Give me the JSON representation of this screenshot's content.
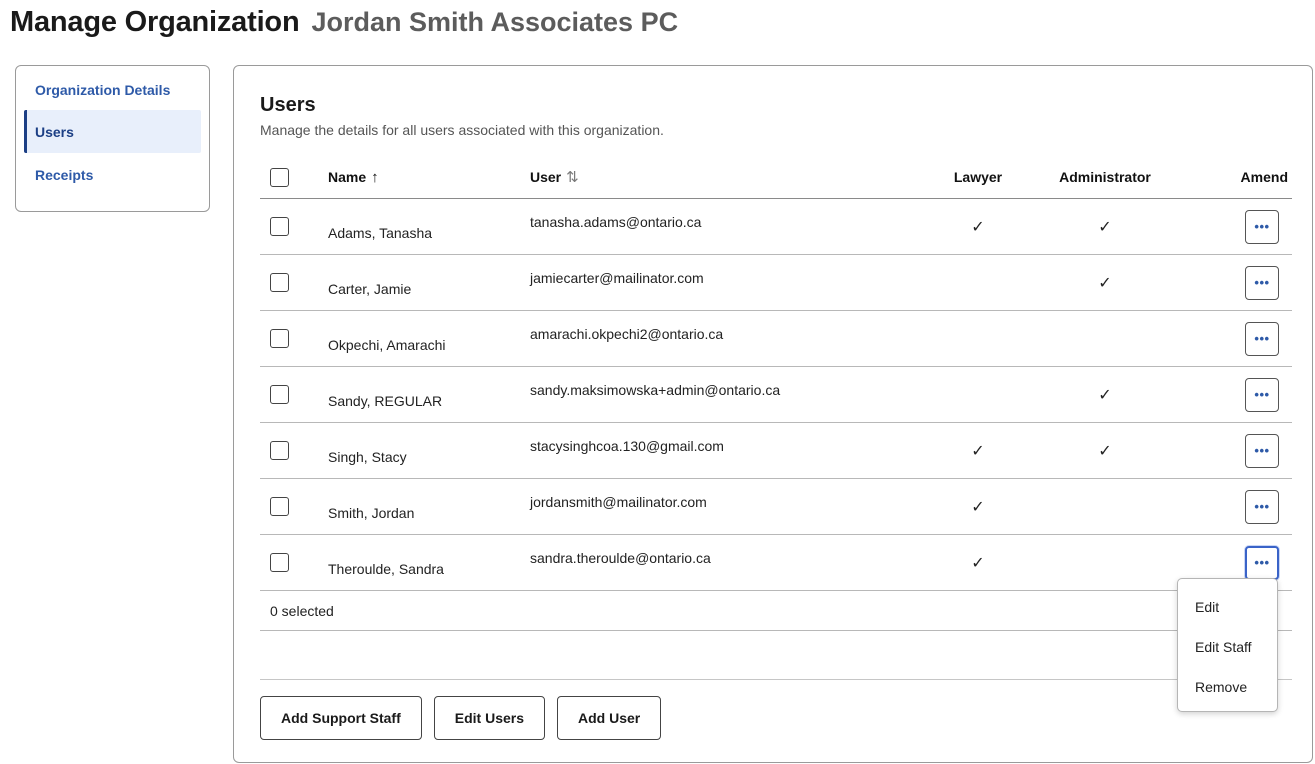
{
  "header": {
    "title": "Manage Organization",
    "org_name": "Jordan Smith Associates PC"
  },
  "sidebar": {
    "items": [
      {
        "label": "Organization Details",
        "active": false
      },
      {
        "label": "Users",
        "active": true
      },
      {
        "label": "Receipts",
        "active": false
      }
    ]
  },
  "users_section": {
    "title": "Users",
    "subtitle": "Manage the details for all users associated with this organization.",
    "columns": {
      "name": "Name",
      "user": "User",
      "lawyer": "Lawyer",
      "administrator": "Administrator",
      "amend": "Amend"
    },
    "sort_icons": {
      "name": "↑",
      "user": "⇅"
    },
    "rows": [
      {
        "name": "Adams, Tanasha",
        "email": "tanasha.adams@ontario.ca",
        "lawyer": "✓",
        "administrator": "✓"
      },
      {
        "name": "Carter, Jamie",
        "email": "jamiecarter@mailinator.com",
        "lawyer": "",
        "administrator": "✓"
      },
      {
        "name": "Okpechi, Amarachi",
        "email": "amarachi.okpechi2@ontario.ca",
        "lawyer": "",
        "administrator": ""
      },
      {
        "name": "Sandy, REGULAR",
        "email": "sandy.maksimowska+admin@ontario.ca",
        "lawyer": "",
        "administrator": "✓"
      },
      {
        "name": "Singh, Stacy",
        "email": "stacysinghcoa.130@gmail.com",
        "lawyer": "✓",
        "administrator": "✓"
      },
      {
        "name": "Smith, Jordan",
        "email": "jordansmith@mailinator.com",
        "lawyer": "✓",
        "administrator": ""
      },
      {
        "name": "Theroulde, Sandra",
        "email": "sandra.theroulde@ontario.ca",
        "lawyer": "✓",
        "administrator": ""
      }
    ],
    "amend_glyph": "•••",
    "selected_text": "0 selected"
  },
  "actions": {
    "add_support_staff": "Add Support Staff",
    "edit_users": "Edit Users",
    "add_user": "Add User"
  },
  "amend_menu": {
    "items": [
      "Edit",
      "Edit Staff",
      "Remove"
    ]
  },
  "colors": {
    "link_blue": "#2e5aa8",
    "active_nav_bg": "#e8effb",
    "focus_blue": "#3a63c8"
  },
  "icons": {
    "check": "check-icon",
    "more": "more-horizontal-icon",
    "sort_asc": "arrow-up-icon",
    "sort_both": "sort-icon"
  }
}
